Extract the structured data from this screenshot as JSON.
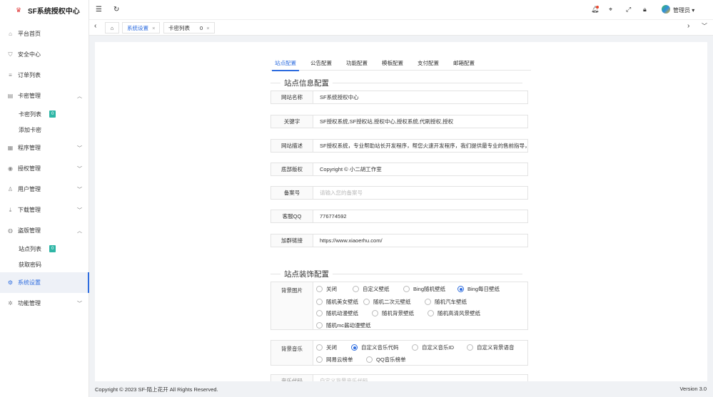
{
  "app": {
    "title": "SF系统授权中心",
    "user": "管理员"
  },
  "sidebar": {
    "items": [
      {
        "label": "平台首页"
      },
      {
        "label": "安全中心"
      },
      {
        "label": "订单列表"
      },
      {
        "label": "卡密管理"
      },
      {
        "label": "程序管理"
      },
      {
        "label": "授权管理"
      },
      {
        "label": "用户管理"
      },
      {
        "label": "下载管理"
      },
      {
        "label": "盗版管理"
      },
      {
        "label": "系统设置"
      },
      {
        "label": "功能管理"
      }
    ],
    "sub_card": [
      {
        "label": "卡密列表",
        "badge": "0"
      },
      {
        "label": "添加卡密"
      }
    ],
    "sub_pirate": [
      {
        "label": "站点列表",
        "badge": "0"
      },
      {
        "label": "获取密码"
      }
    ]
  },
  "tabs": {
    "t1": "系统设置",
    "t2": "卡密列表",
    "t2_count": "0"
  },
  "content_tabs": [
    "站点配置",
    "公告配置",
    "功能配置",
    "模板配置",
    "支付配置",
    "邮箱配置"
  ],
  "section1": "站点信息配置",
  "fields": [
    {
      "label": "网站名称",
      "value": "SF系统授权中心"
    },
    {
      "label": "关键字",
      "value": "SF授权系统,SF授权站,授权中心,授权系统,代刷授权,授权"
    },
    {
      "label": "网站描述",
      "value": "SF授权系统，专业帮助站长开发程序，帮您火速开发程序，我们提供最专业的售前指导，提"
    },
    {
      "label": "底部版权",
      "value": "Copyright © 小二胡工作室"
    },
    {
      "label": "备案号",
      "placeholder": "请输入您的备案号"
    },
    {
      "label": "客服QQ",
      "value": "776774592"
    },
    {
      "label": "加群链接",
      "value": "https://www.xiaoerhu.com/"
    }
  ],
  "section2": "站点装饰配置",
  "bg_image": {
    "label": "背景图片",
    "options": [
      "关闭",
      "自定义壁纸",
      "Bing随机壁纸",
      "Bing每日壁纸",
      "随机美女壁纸",
      "随机二次元壁纸",
      "随机汽车壁纸",
      "随机动漫壁纸",
      "随机背景壁纸",
      "随机高清风景壁纸",
      "随机mc酱动漫壁纸"
    ],
    "selected": "Bing每日壁纸"
  },
  "bg_music": {
    "label": "背景音乐",
    "options": [
      "关闭",
      "自定义音乐代码",
      "自定义音乐ID",
      "自定义背景语音",
      "网易云榜单",
      "QQ音乐榜单"
    ],
    "selected": "自定义音乐代码"
  },
  "partial_row": {
    "label": "音乐代码",
    "placeholder": "自定义背景音乐代码"
  },
  "footer": {
    "copyright": "Copyright © 2023 SF-陌上花开 All Rights Reserved.",
    "version": "Version 3.0"
  },
  "colors": {
    "accent": "#2d6cdf",
    "badge": "#2fb6a6"
  }
}
